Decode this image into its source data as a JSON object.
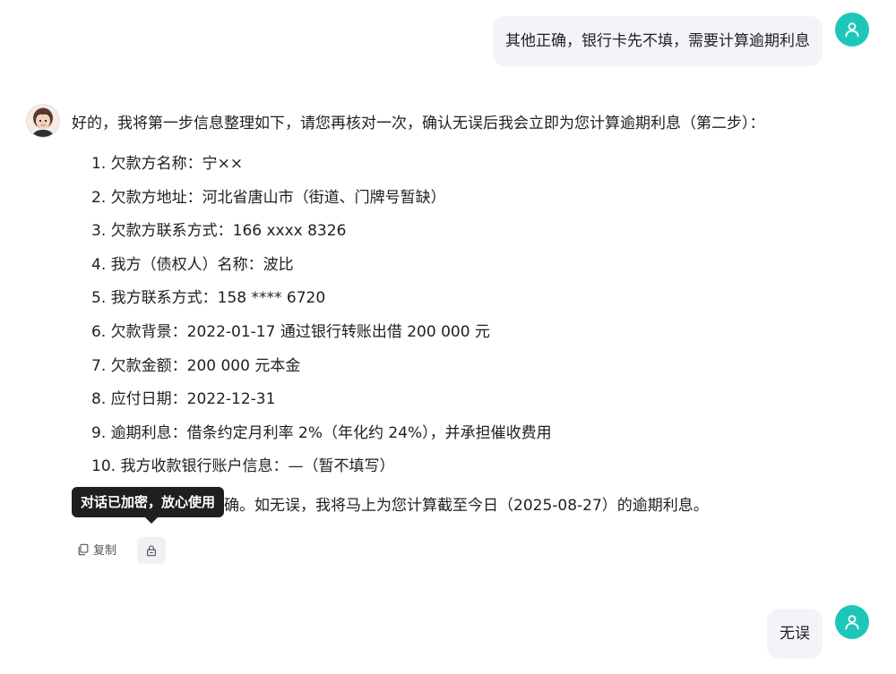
{
  "messages": {
    "user_1": "其他正确，银行卡先不填，需要计算逾期利息",
    "assistant": {
      "intro": "好的，我将第一步信息整理如下，请您再核对一次，确认无误后我会立即为您计算逾期利息（第二步）：",
      "items": [
        "1. 欠款方名称：宁××",
        "2. 欠款方地址：河北省唐山市（街道、门牌号暂缺）",
        "3. 欠款方联系方式：166 xxxx 8326",
        "4. 我方（债权人）名称：波比",
        "5. 我方联系方式：158 **** 6720",
        "6. 欠款背景：2022-01-17 通过银行转账出借 200 000 元",
        "7. 欠款金额：200 000 元本金",
        "8. 应付日期：2022-12-31",
        "9. 逾期利息：借条约定月利率 2%（年化约 24%），并承担催收费用",
        "10. 我方收款银行账户信息：—（暂不填写）"
      ],
      "closing": "请确认以上信息是否准确。如无误，我将马上为您计算截至今日（2025-08-27）的逾期利息。"
    },
    "user_2": "无误"
  },
  "tooltip": "对话已加密，放心使用",
  "actions": {
    "copy_label": "复制",
    "lock_icon": "lock-icon"
  },
  "colors": {
    "accent": "#1cc7ba",
    "user_bubble": "#f3f4f8",
    "tooltip_bg": "#1f1f1f"
  }
}
